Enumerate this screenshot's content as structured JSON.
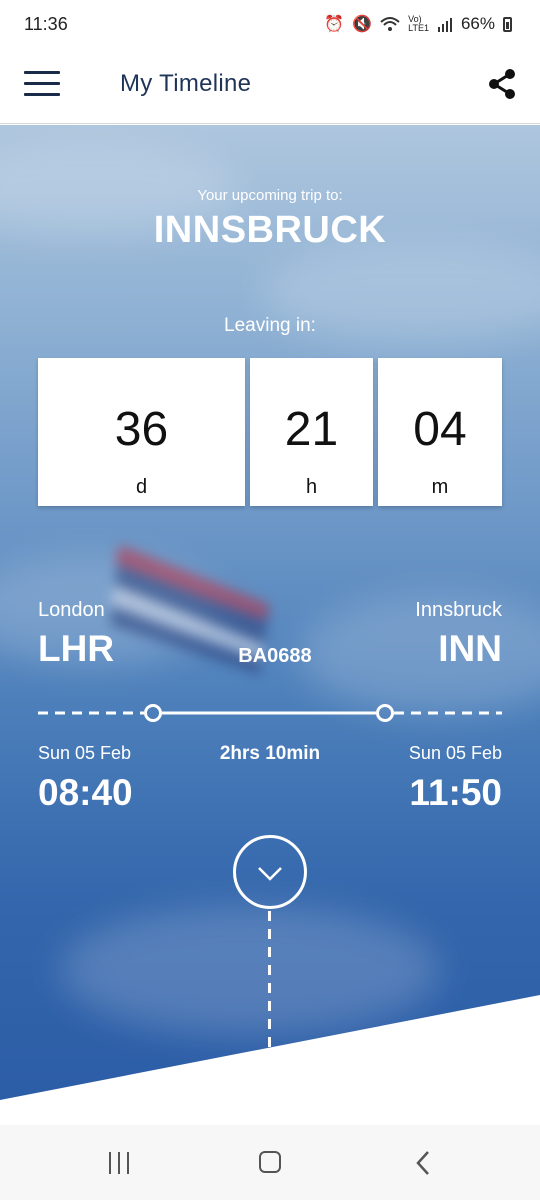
{
  "status": {
    "time": "11:36",
    "battery": "66%"
  },
  "header": {
    "title": "My Timeline"
  },
  "trip": {
    "label": "Your upcoming trip to:",
    "destination": "INNSBRUCK"
  },
  "countdown": {
    "label": "Leaving in:",
    "days": {
      "value": "36",
      "unit": "d"
    },
    "hours": {
      "value": "21",
      "unit": "h"
    },
    "minutes": {
      "value": "04",
      "unit": "m"
    }
  },
  "flight": {
    "number": "BA0688",
    "duration": "2hrs 10min",
    "departure": {
      "city": "London",
      "code": "LHR",
      "date": "Sun 05 Feb",
      "time": "08:40"
    },
    "arrival": {
      "city": "Innsbruck",
      "code": "INN",
      "date": "Sun 05 Feb",
      "time": "11:50"
    }
  },
  "icons": {
    "menu": "hamburger-icon",
    "share": "share-icon",
    "expand": "chevron-down-icon",
    "nav_recent": "recent-apps-icon",
    "nav_home": "home-icon",
    "nav_back": "back-icon"
  },
  "colors": {
    "brand_navy": "#1f3558",
    "sky_blue": "#2b5ca6",
    "white": "#ffffff"
  }
}
